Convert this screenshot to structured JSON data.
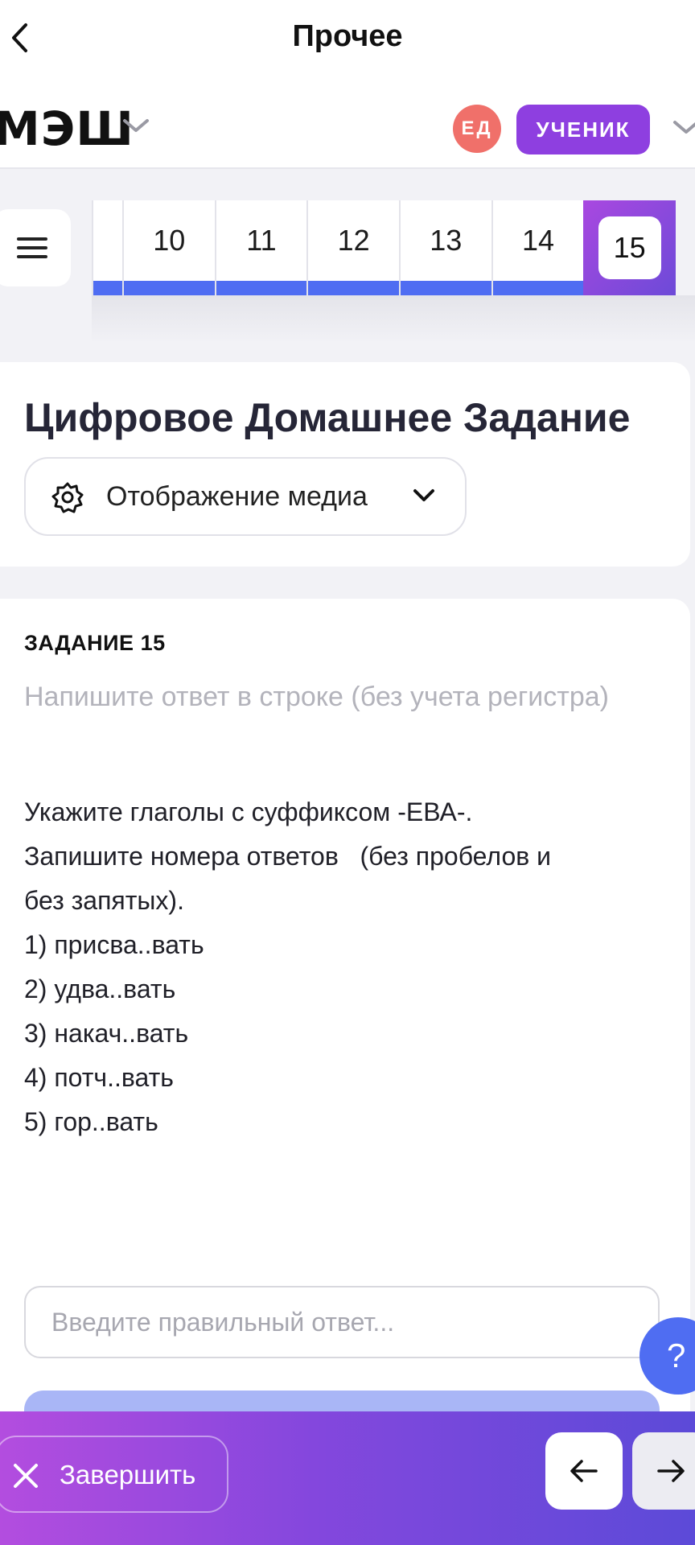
{
  "topbar": {
    "title": "Прочее"
  },
  "brand": {
    "logo": "МЭШ"
  },
  "user": {
    "initials": "ЕД",
    "role": "УЧЕНИК"
  },
  "task_strip": {
    "items": [
      "10",
      "11",
      "12",
      "13",
      "14",
      "15"
    ],
    "active": "15"
  },
  "card": {
    "title": "Цифровое Домашнее Задание",
    "media_dropdown": "Отображение медиа"
  },
  "task": {
    "label": "ЗАДАНИЕ 15",
    "hint": "Напишите ответ в строке (без учета регистра)",
    "lines": [
      "Укажите глаголы с суффиксом -ЕВА-.",
      "Запишите номера ответов   (без пробелов и",
      "без запятых).",
      "1) присва..вать",
      "2) удва..вать",
      "3) накач..вать",
      "4) потч..вать",
      "5) гор..вать"
    ],
    "answer_placeholder": "Введите правильный ответ..."
  },
  "help": {
    "label": "?"
  },
  "bottombar": {
    "finish_label": "Завершить"
  },
  "colors": {
    "accent_blue": "#4f6df2",
    "accent_purple": "#8e3fe0",
    "avatar": "#f0706a"
  }
}
